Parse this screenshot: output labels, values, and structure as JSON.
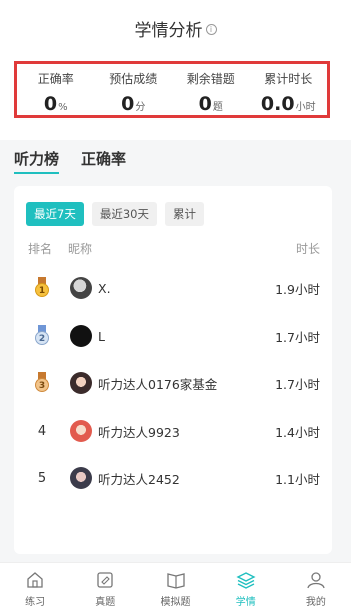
{
  "header": {
    "title": "学情分析"
  },
  "stats": [
    {
      "label": "正确率",
      "value": "0",
      "unit": "%"
    },
    {
      "label": "预估成绩",
      "value": "0",
      "unit": "分"
    },
    {
      "label": "剩余错题",
      "value": "0",
      "unit": "题"
    },
    {
      "label": "累计时长",
      "value": "0.0",
      "unit": "小时"
    }
  ],
  "tabs": [
    {
      "label": "听力榜",
      "active": true
    },
    {
      "label": "正确率",
      "active": false
    }
  ],
  "filters": [
    {
      "label": "最近7天",
      "active": true
    },
    {
      "label": "最近30天",
      "active": false
    },
    {
      "label": "累计",
      "active": false
    }
  ],
  "table": {
    "headers": {
      "rank": "排名",
      "name": "昵称",
      "duration": "时长"
    },
    "rows": [
      {
        "rank": "1",
        "name": "X.",
        "duration": "1.9小时"
      },
      {
        "rank": "2",
        "name": "L",
        "duration": "1.7小时"
      },
      {
        "rank": "3",
        "name": "听力达人0176家基金",
        "duration": "1.7小时"
      },
      {
        "rank": "4",
        "name": "听力达人9923",
        "duration": "1.4小时"
      },
      {
        "rank": "5",
        "name": "听力达人2452",
        "duration": "1.1小时"
      }
    ]
  },
  "nav": [
    {
      "label": "练习",
      "icon": "home-icon"
    },
    {
      "label": "真题",
      "icon": "exam-paper-icon"
    },
    {
      "label": "模拟题",
      "icon": "book-icon"
    },
    {
      "label": "学情",
      "icon": "layers-icon",
      "active": true
    },
    {
      "label": "我的",
      "icon": "person-icon"
    }
  ],
  "colors": {
    "accent": "#1fbfbf",
    "highlight_border": "#e03a3a"
  }
}
